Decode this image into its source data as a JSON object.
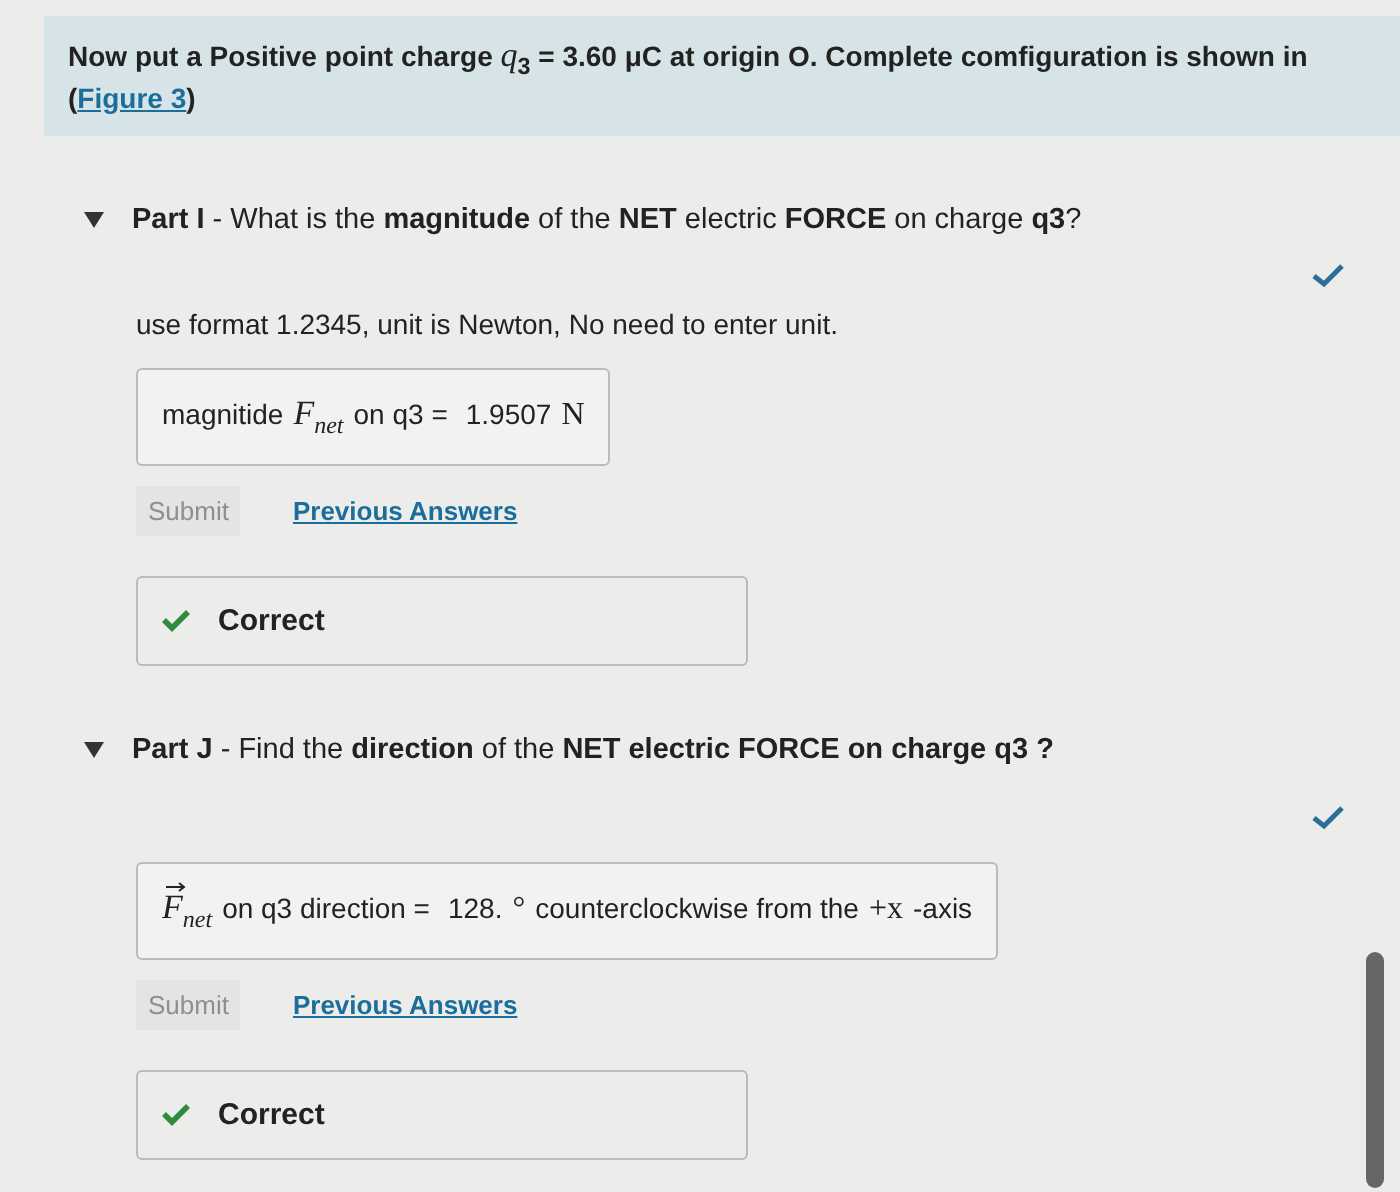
{
  "intro": {
    "before": "Now put a Positive point charge *q*$_{3}$ = 3.60 μC at origin O. Complete comfiguration is shown in (",
    "link": "Figure 3",
    "after": ")"
  },
  "parts": [
    {
      "expanded": true,
      "correct": true,
      "title": "**Part I** - What is the **magnitude** of the **NET** electric **FORCE** on charge **q3**?",
      "instruction": "use format 1.2345, unit is Newton, No need to enter unit.",
      "answer": [
        {
          "kind": "text",
          "text": "magnitide"
        },
        {
          "kind": "math",
          "text": "F",
          "sub": "net",
          "vector": false
        },
        {
          "kind": "text",
          "text": "on q3 ="
        },
        {
          "kind": "value",
          "text": "1.9507"
        },
        {
          "kind": "unit",
          "text": "N"
        }
      ],
      "submit": {
        "label": "Submit",
        "disabled": true
      },
      "previous": "Previous Answers",
      "feedback": "Correct"
    },
    {
      "expanded": true,
      "correct": true,
      "title": "**Part J** - Find the **direction** of the **NET electric FORCE on charge q3 ?**",
      "answer": [
        {
          "kind": "math",
          "text": "F",
          "sub": "net",
          "vector": true
        },
        {
          "kind": "text",
          "text": "on q3 direction ="
        },
        {
          "kind": "value",
          "text": "128."
        },
        {
          "kind": "unit",
          "text": "°"
        },
        {
          "kind": "text",
          "text": "counterclockwise from the"
        },
        {
          "kind": "unit",
          "text": "+x"
        },
        {
          "kind": "text",
          "text": "-axis"
        }
      ],
      "submit": {
        "label": "Submit",
        "disabled": true
      },
      "previous": "Previous Answers",
      "feedback": "Correct"
    }
  ]
}
